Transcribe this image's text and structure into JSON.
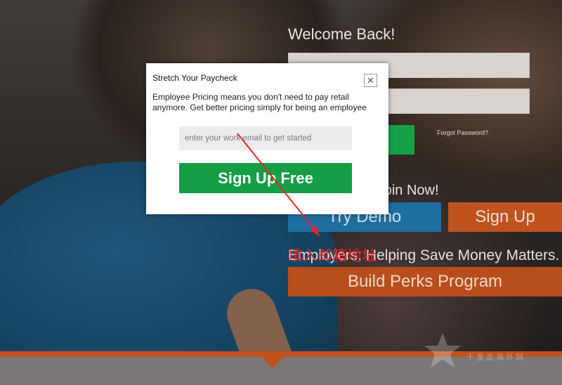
{
  "login": {
    "welcome": "Welcome Back!",
    "forgot_password": "Forgot Password?"
  },
  "promo": {
    "tagline_1": "...ing Matters. Join Now!",
    "try_demo": "Try Demo",
    "sign_up": "Sign Up",
    "tagline_2": "Employers: Helping Save Money Matters.",
    "build_perks": "Build Perks Program"
  },
  "modal": {
    "title": "Stretch Your Paycheck",
    "close_icon": "close-icon",
    "description": "Employee Pricing means you don't need to pay retail anymore. Get better pricing simply for being an employee",
    "email_placeholder": "enter your work email to get started",
    "email_value": "",
    "submit_label": "Sign Up Free"
  },
  "annotation": {
    "text": "填入邮箱地址",
    "color": "#e5242a"
  },
  "watermark": {
    "text": "千里走海外网"
  },
  "colors": {
    "green": "#159e45",
    "blue": "#1e6ea0",
    "orange": "#c0521e"
  }
}
